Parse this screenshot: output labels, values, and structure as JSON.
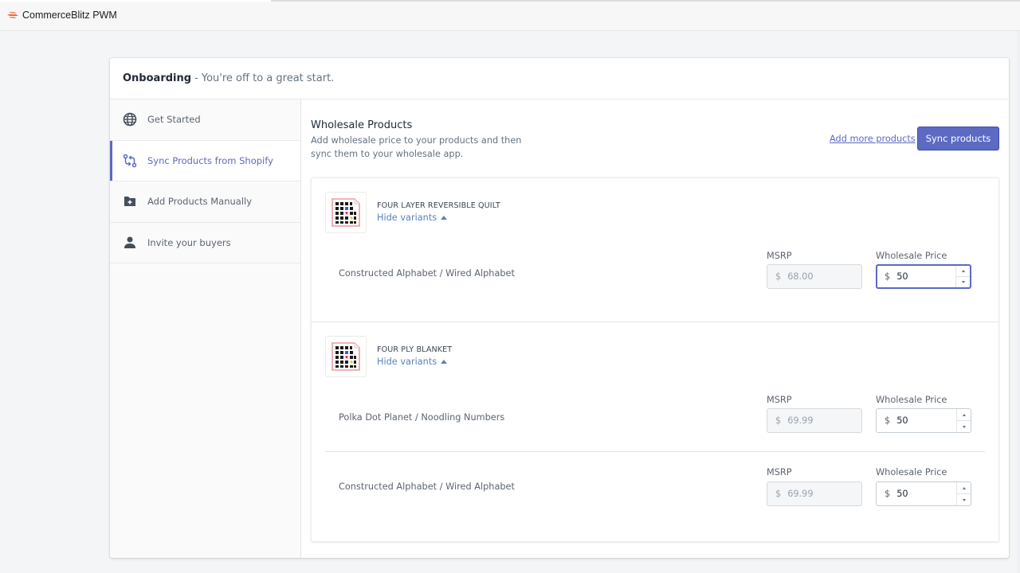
{
  "window": {
    "app_title": "CommerceBlitz PWM",
    "logo_icon": "commerceblitz-logo-icon"
  },
  "header": {
    "title": "Onboarding",
    "subtitle": "- You're off to a great start."
  },
  "sidebar": {
    "items": [
      {
        "label": "Get Started",
        "icon": "globe-icon",
        "active": false
      },
      {
        "label": "Sync Products from Shopify",
        "icon": "sync-icon",
        "active": true
      },
      {
        "label": "Add Products Manually",
        "icon": "folder-add-icon",
        "active": false
      },
      {
        "label": "Invite your buyers",
        "icon": "person-icon",
        "active": false
      }
    ]
  },
  "main": {
    "title": "Wholesale Products",
    "description": "Add wholesale price to your products and then sync them to your wholesale app.",
    "add_more_label": "Add more products",
    "sync_label": "Sync products",
    "accent_color": "#5c6ac4",
    "products": [
      {
        "name": "FOUR LAYER REVERSIBLE QUILT",
        "toggle_label": "Hide variants",
        "variants": [
          {
            "name": "Constructed Alphabet / Wired Alphabet",
            "msrp_label": "MSRP",
            "currency": "$",
            "msrp": "68.00",
            "wholesale_label": "Wholesale Price",
            "wholesale": "50",
            "focused": true
          }
        ]
      },
      {
        "name": "FOUR PLY BLANKET",
        "toggle_label": "Hide variants",
        "variants": [
          {
            "name": "Polka Dot Planet / Noodling Numbers",
            "msrp_label": "MSRP",
            "currency": "$",
            "msrp": "69.99",
            "wholesale_label": "Wholesale Price",
            "wholesale": "50",
            "focused": false
          },
          {
            "name": "Constructed Alphabet / Wired Alphabet",
            "msrp_label": "MSRP",
            "currency": "$",
            "msrp": "69.99",
            "wholesale_label": "Wholesale Price",
            "wholesale": "50",
            "focused": false
          }
        ]
      }
    ]
  }
}
